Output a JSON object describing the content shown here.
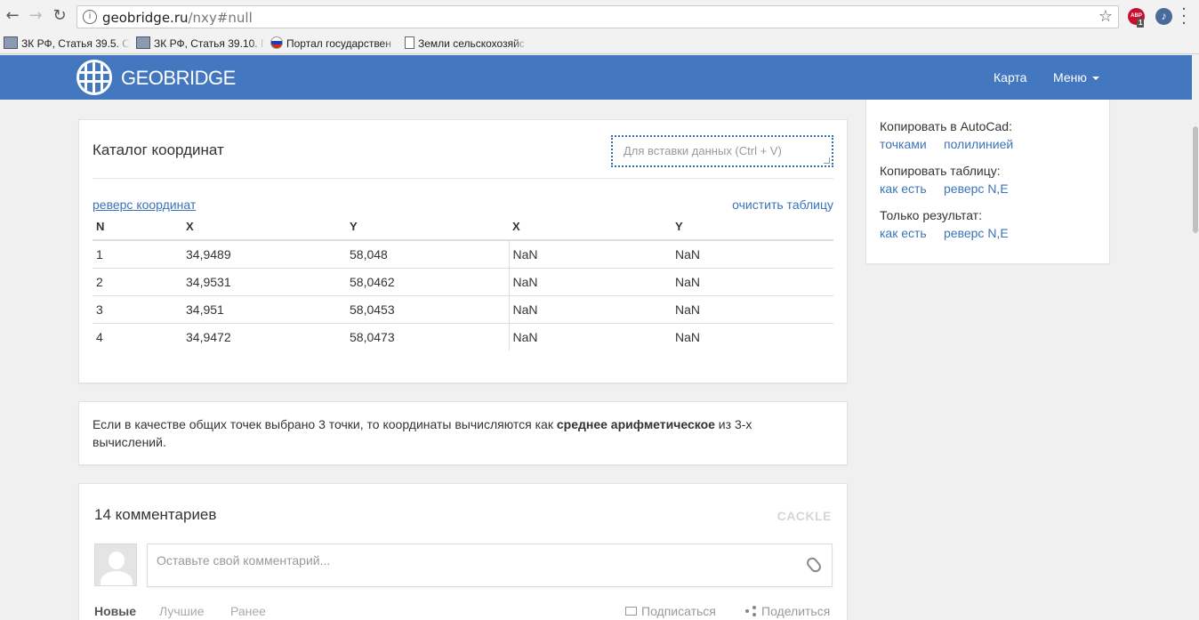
{
  "browser": {
    "url_host": "geobridge.ru",
    "url_path": "/nxy#null",
    "extension_badge": "1",
    "abp_label": "ABP",
    "bookmarks": [
      {
        "label": "ЗК РФ, Статья 39.5. С",
        "icon": "person-icon"
      },
      {
        "label": "ЗК РФ, Статья 39.10. П",
        "icon": "person-icon"
      },
      {
        "label": "Портал государствен",
        "icon": "russia-flag-icon"
      },
      {
        "label": "Земли сельскохозяйс",
        "icon": "document-icon"
      }
    ]
  },
  "navbar": {
    "brand": "GEOBRIDGE",
    "links": {
      "map": "Карта",
      "menu": "Меню"
    }
  },
  "catalog": {
    "title": "Каталог координат",
    "paste_placeholder": "Для вставки данных (Ctrl + V)",
    "reverse_link": "реверс координат",
    "clear_link": "очистить таблицу",
    "columns": [
      "N",
      "X",
      "Y",
      "X",
      "Y"
    ],
    "rows": [
      [
        "1",
        "34,9489",
        "58,048",
        "NaN",
        "NaN"
      ],
      [
        "2",
        "34,9531",
        "58,0462",
        "NaN",
        "NaN"
      ],
      [
        "3",
        "34,951",
        "58,0453",
        "NaN",
        "NaN"
      ],
      [
        "4",
        "34,9472",
        "58,0473",
        "NaN",
        "NaN"
      ]
    ]
  },
  "note": {
    "before": "Если в качестве общих точек выбрано 3 точки, то координаты вычисляются как ",
    "bold": "среднее арифметическое",
    "after": " из 3-х вычислений."
  },
  "comments": {
    "title": "14 комментариев",
    "provider": "CACKLE",
    "input_placeholder": "Оставьте свой комментарий...",
    "tabs": [
      "Новые",
      "Лучшие",
      "Ранее"
    ],
    "subscribe": "Подписаться",
    "share": "Поделиться"
  },
  "sidebar": {
    "autocad_label": "Копировать в AutoCad:",
    "autocad_points": "точками",
    "autocad_polyline": "полилинией",
    "table_label": "Копировать таблицу:",
    "table_as_is": "как есть",
    "table_reverse": "реверс N,E",
    "result_label": "Только результат:",
    "result_as_is": "как есть",
    "result_reverse": "реверс N,E"
  },
  "colors": {
    "navbar": "#4377c0",
    "link": "#3a74b9"
  }
}
